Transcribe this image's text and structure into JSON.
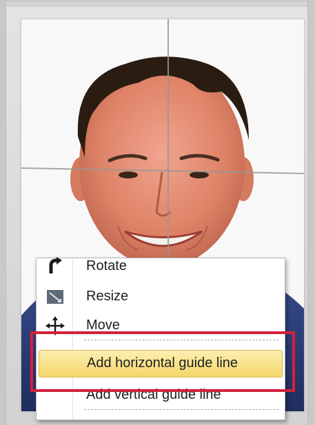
{
  "photo": {
    "subject": "portrait-photo"
  },
  "context_menu": {
    "items": [
      {
        "label": "Rotate",
        "icon": "rotate-icon"
      },
      {
        "label": "Resize",
        "icon": "resize-icon"
      },
      {
        "label": "Move",
        "icon": "move-icon"
      },
      {
        "label": "Add horizontal guide line",
        "icon": "",
        "highlighted": true
      },
      {
        "label": "Add vertical guide line",
        "icon": ""
      }
    ]
  },
  "colors": {
    "highlight": "#f5d66a",
    "annotation": "#d3203a",
    "guide": "#969696"
  }
}
